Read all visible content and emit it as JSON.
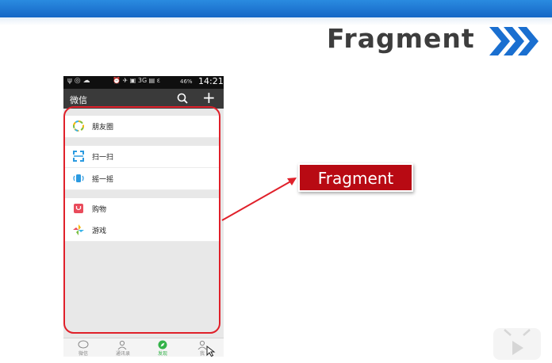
{
  "slide": {
    "title": "Fragment",
    "callout_label": "Fragment",
    "accent_colors": {
      "title_chevrons": "#1a6fd0",
      "frame": "#e0202a",
      "callout": "#b80a13",
      "topbar": "#1566c6"
    }
  },
  "phone": {
    "status_bar": {
      "left_icons": "ψ ◎ ☁",
      "mid_icons": "⏰ ✈ ▣ 3G ▤ ε",
      "battery": "46%",
      "time": "14:21"
    },
    "app_bar": {
      "title": "微信",
      "search_icon": "search-icon",
      "plus_label": "+"
    },
    "menu": [
      {
        "label": "朋友圈",
        "icon": "moments-icon"
      },
      {
        "label": "扫一扫",
        "icon": "scan-icon"
      },
      {
        "label": "摇一摇",
        "icon": "shake-icon"
      },
      {
        "label": "购物",
        "icon": "shopping-icon"
      },
      {
        "label": "游戏",
        "icon": "game-icon"
      }
    ],
    "bottom_nav": [
      {
        "label": "微信",
        "icon": "chat-icon"
      },
      {
        "label": "通讯录",
        "icon": "contacts-icon"
      },
      {
        "label": "发现",
        "icon": "discover-icon"
      },
      {
        "label": "我",
        "icon": "me-icon"
      }
    ]
  }
}
